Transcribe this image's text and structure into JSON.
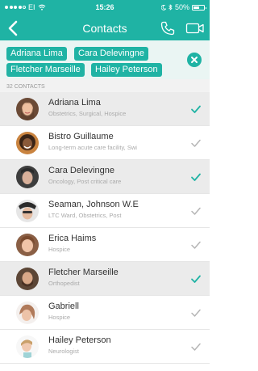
{
  "status_bar": {
    "carrier": "EI",
    "time": "15:26",
    "battery": "50%"
  },
  "nav": {
    "title": "Contacts"
  },
  "selected_chips": [
    "Adriana Lima",
    "Cara Delevingne",
    "Fletcher Marseille",
    "Hailey Peterson"
  ],
  "list": {
    "count_label": "32 CONTACTS",
    "contacts": [
      {
        "name": "Adriana Lima",
        "detail": "Obstetrics, Surgical, Hospice",
        "selected": true
      },
      {
        "name": "Bistro Guillaume",
        "detail": "Long-term acute care facility, Swi",
        "selected": false
      },
      {
        "name": "Cara Delevingne",
        "detail": "Oncology, Post critical care",
        "selected": true
      },
      {
        "name": "Seaman, Johnson W.E",
        "detail": "LTC Ward, Obstetrics, Post",
        "selected": false
      },
      {
        "name": "Erica Haims",
        "detail": "Hospice",
        "selected": false
      },
      {
        "name": "Fletcher Marseille",
        "detail": "Orthopedist",
        "selected": true
      },
      {
        "name": "Gabriell",
        "detail": "Hospice",
        "selected": false
      },
      {
        "name": "Hailey Peterson",
        "detail": "Neurologist",
        "selected": false
      }
    ]
  },
  "colors": {
    "accent": "#1fb3a4",
    "chip_area": "#eaf5f3",
    "check_inactive": "#b5b5b5"
  },
  "icons": {
    "back": "chevron-left-icon",
    "phone": "phone-icon",
    "video": "video-camera-icon",
    "clear": "close-icon",
    "check": "check-icon"
  }
}
